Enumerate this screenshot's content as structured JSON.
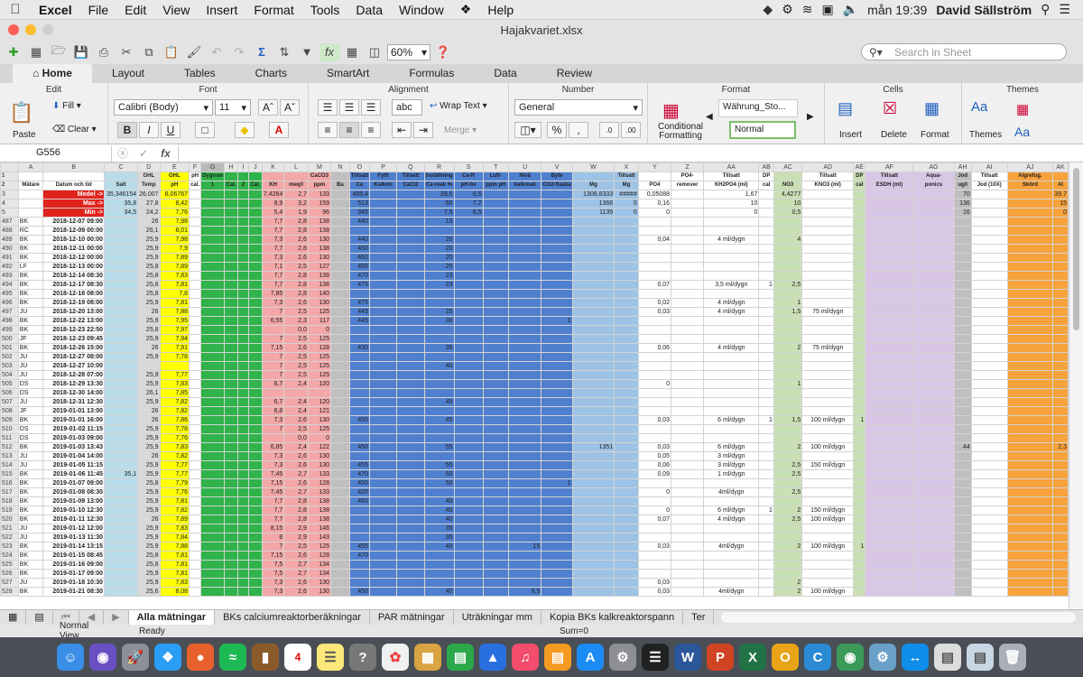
{
  "menubar": {
    "app": "Excel",
    "items": [
      "File",
      "Edit",
      "View",
      "Insert",
      "Format",
      "Tools",
      "Data",
      "Window",
      "Help"
    ],
    "clock": "mån 19:39",
    "user": "David Sällström"
  },
  "window": {
    "title": "Hajakvariet.xlsx"
  },
  "toolbar": {
    "zoom": "60%",
    "search_placeholder": "Search in Sheet"
  },
  "ribbon_tabs": [
    "Home",
    "Layout",
    "Tables",
    "Charts",
    "SmartArt",
    "Formulas",
    "Data",
    "Review"
  ],
  "ribbon": {
    "edit": {
      "label": "Edit",
      "paste": "Paste",
      "fill": "Fill",
      "clear": "Clear"
    },
    "font": {
      "label": "Font",
      "name": "Calibri (Body)",
      "size": "11",
      "bold": "B",
      "italic": "I",
      "underline": "U"
    },
    "alignment": {
      "label": "Alignment",
      "abc": "abc",
      "wrap": "Wrap Text",
      "merge": "Merge"
    },
    "number": {
      "label": "Number",
      "format": "General"
    },
    "format": {
      "label": "Format",
      "cond": "Conditional Formatting",
      "style1": "Währung_Sto...",
      "style2": "Normal"
    },
    "cells": {
      "label": "Cells",
      "insert": "Insert",
      "delete": "Delete",
      "format": "Format"
    },
    "themes": {
      "label": "Themes",
      "themes": "Themes"
    }
  },
  "formula": {
    "cell": "G556",
    "fx": "fx"
  },
  "columns": [
    "A",
    "B",
    "C",
    "D",
    "E",
    "F",
    "G",
    "H",
    "I",
    "J",
    "K",
    "L",
    "M",
    "N",
    "O",
    "P",
    "Q",
    "R",
    "S",
    "T",
    "U",
    "V",
    "W",
    "X",
    "Y",
    "Z",
    "AA",
    "AB",
    "AC",
    "AD",
    "AE",
    "AF",
    "AG",
    "AH",
    "AI",
    "AJ",
    "AK"
  ],
  "header1": [
    "",
    "",
    "",
    "GHL",
    "GHL",
    "pH",
    "Dygnsw",
    "",
    "",
    "",
    "",
    "",
    "CaCO3",
    "",
    "Tillsatt",
    "Fyllt",
    "Tillsatt",
    "Inställning",
    "Ca-R",
    "Luft-",
    "Nivå",
    "Byte",
    "",
    "Tillsatt",
    "",
    "PO4-",
    "Tillsatt",
    "DP",
    "",
    "Tillsatt",
    "DP",
    "Tillsatt",
    "Aqua-",
    "Jod",
    "Tillsatt",
    "Algrefug.",
    ""
  ],
  "header2": [
    "Mätare",
    "Datum och tid",
    "Salt",
    "Temp",
    "pH",
    "cal.",
    "1",
    "Cal.",
    "2",
    "Cal.",
    "KH",
    "meq/l",
    "ppm",
    "Ba",
    "Ca",
    "Kalkroi",
    "CaCl2",
    "Ca-reak %",
    "pH-bv",
    "ppm pH",
    "kalkreak",
    "CO2-flaska",
    "Mg",
    "Mg",
    "PO4",
    "remover",
    "KH2PO4 (ml)",
    "cal",
    "NO3",
    "KNO3 (ml)",
    "cal",
    "ESDH (ml)",
    "ponics",
    "ug/l",
    "Jod (10X)",
    "Skörd",
    "Al"
  ],
  "summary": [
    {
      "row": "3",
      "label": "Medel ->",
      "c": "35,346154",
      "d": "26,007",
      "e": "8,06767",
      "k": "7,4264",
      "l": "2,7",
      "m": "133",
      "o": "455,4",
      "r": "28,6",
      "s": "6,5",
      "w": "1308,8333",
      "x": "#####",
      "y": "0,05088",
      "aa": "1,67",
      "ac": "4,4277",
      "ah": "70",
      "ak": "39,7"
    },
    {
      "row": "4",
      "label": "Max ->",
      "c": "35,8",
      "d": "27,8",
      "e": "8,42",
      "k": "8,9",
      "l": "3,2",
      "m": "159",
      "o": "513",
      "r": "60",
      "s": "7,2",
      "w": "1366",
      "x": "0",
      "y": "0,16",
      "aa": "10",
      "ac": "10",
      "ah": "136",
      "ak": "15"
    },
    {
      "row": "5",
      "label": "Min ->",
      "c": "34,5",
      "d": "24,2",
      "e": "7,76",
      "k": "5,4",
      "l": "1,9",
      "m": "96",
      "o": "345",
      "r": "7,5",
      "s": "6,5",
      "w": "1135",
      "x": "0",
      "y": "0",
      "aa": "0",
      "ac": "0,5",
      "ah": "16",
      "ak": "0"
    }
  ],
  "rows": [
    {
      "r": "487",
      "a": "BK",
      "b": "2018-12-07 09:00",
      "d": "26",
      "e": "7,98",
      "k": "7,7",
      "l": "2,8",
      "m": "138",
      "o": "440",
      "r2": "15"
    },
    {
      "r": "488",
      "a": "RC",
      "b": "2018-12-09 00:00",
      "d": "26,1",
      "e": "8,01",
      "k": "7,7",
      "l": "2,8",
      "m": "138"
    },
    {
      "r": "489",
      "a": "BK",
      "b": "2018-12-10 00:00",
      "d": "25,9",
      "e": "7,98",
      "k": "7,3",
      "l": "2,6",
      "m": "130",
      "o": "440",
      "r2": "20",
      "y": "0,04",
      "aa": "4 ml/dygn",
      "ac": "4"
    },
    {
      "r": "490",
      "a": "BK",
      "b": "2018-12-11 00:00",
      "d": "25,9",
      "e": "7,9",
      "k": "7,7",
      "l": "2,8",
      "m": "138",
      "o": "450",
      "r2": "20"
    },
    {
      "r": "491",
      "a": "BK",
      "b": "2018-12-12 00:00",
      "d": "25,9",
      "e": "7,89",
      "k": "7,3",
      "l": "2,6",
      "m": "130",
      "o": "460",
      "r2": "20"
    },
    {
      "r": "492",
      "a": "LF",
      "b": "2018-12-13 00:00",
      "d": "25,8",
      "e": "7,89",
      "k": "7,1",
      "l": "2,5",
      "m": "127",
      "o": "450",
      "r2": "25"
    },
    {
      "r": "493",
      "a": "BK",
      "b": "2018-12-14 08:30",
      "d": "25,8",
      "e": "7,83",
      "k": "7,7",
      "l": "2,8",
      "m": "138",
      "o": "470",
      "r2": "23"
    },
    {
      "r": "494",
      "a": "BK",
      "b": "2018-12-17 08:30",
      "d": "25,8",
      "e": "7,81",
      "k": "7,7",
      "l": "2,8",
      "m": "138",
      "o": "475",
      "r2": "23",
      "y": "0,07",
      "aa": "3,5 ml/dygn",
      "ab": "1",
      "ac": "2,5"
    },
    {
      "r": "495",
      "a": "BK",
      "b": "2018-12-18 08:00",
      "d": "25,8",
      "e": "7,8",
      "k": "7,85",
      "l": "2,8",
      "m": "140"
    },
    {
      "r": "496",
      "a": "BK",
      "b": "2018-12-19 08:00",
      "d": "25,9",
      "e": "7,81",
      "k": "7,3",
      "l": "2,6",
      "m": "130",
      "o": "475",
      "y": "0,02",
      "aa": "4 ml/dygn",
      "ac": "1"
    },
    {
      "r": "497",
      "a": "JU",
      "b": "2018-12-20 13:00",
      "d": "26",
      "e": "7,88",
      "k": "7",
      "l": "2,5",
      "m": "125",
      "o": "445",
      "r2": "25",
      "y": "0,03",
      "aa": "4 ml/dygn",
      "ac": "1,5",
      "ad": "75 ml/dygn"
    },
    {
      "r": "498",
      "a": "BK",
      "b": "2018-12-22 13:00",
      "d": "25,9",
      "e": "7,95",
      "k": "6,55",
      "l": "2,3",
      "m": "117",
      "o": "445",
      "r2": "30",
      "v": "1"
    },
    {
      "r": "499",
      "a": "BK",
      "b": "2018-12-23 22:50",
      "d": "25,8",
      "e": "7,97",
      "l": "0,0",
      "m": "0"
    },
    {
      "r": "500",
      "a": "JF",
      "b": "2018-12-23 09:45",
      "d": "25,9",
      "e": "7,94",
      "k": "7",
      "l": "2,5",
      "m": "125"
    },
    {
      "r": "501",
      "a": "BK",
      "b": "2018-12-26 15:00",
      "d": "26",
      "e": "7,91",
      "k": "7,15",
      "l": "2,6",
      "m": "128",
      "o": "430",
      "r2": "35",
      "y": "0,06",
      "aa": "4 ml/dygn",
      "ac": "2",
      "ad": "75 ml/dygn"
    },
    {
      "r": "502",
      "a": "JU",
      "b": "2018-12-27 08:00",
      "d": "25,9",
      "e": "7,78",
      "k": "7",
      "l": "2,5",
      "m": "125"
    },
    {
      "r": "503",
      "a": "JU",
      "b": "2018-12-27 10:00",
      "k": "7",
      "l": "2,5",
      "m": "125",
      "r2": "40"
    },
    {
      "r": "504",
      "a": "JU",
      "b": "2018-12-28 07:00",
      "d": "25,9",
      "e": "7,77",
      "k": "7",
      "l": "2,5",
      "m": "125"
    },
    {
      "r": "505",
      "a": "DS",
      "b": "2018-12-29 13:30",
      "d": "25,9",
      "e": "7,83",
      "k": "6,7",
      "l": "2,4",
      "m": "120",
      "y": "0",
      "ac": "1"
    },
    {
      "r": "506",
      "a": "DS",
      "b": "2018-12-30 14:00",
      "d": "26,1",
      "e": "7,85"
    },
    {
      "r": "507",
      "a": "JU",
      "b": "2018-12-31 12:30",
      "d": "25,9",
      "e": "7,82",
      "k": "6,7",
      "l": "2,4",
      "m": "120",
      "r2": "45"
    },
    {
      "r": "508",
      "a": "JF",
      "b": "2019-01-01 13:00",
      "d": "26",
      "e": "7,82",
      "k": "6,8",
      "l": "2,4",
      "m": "121"
    },
    {
      "r": "509",
      "a": "BK",
      "b": "2019-01-01 16:00",
      "d": "26",
      "e": "7,86",
      "k": "7,3",
      "l": "2,6",
      "m": "130",
      "o": "450",
      "r2": "45",
      "y": "0,03",
      "aa": "6 ml/dygn",
      "ab": "1",
      "ac": "1,5",
      "ad": "100 ml/dygn",
      "ae": "1"
    },
    {
      "r": "510",
      "a": "DS",
      "b": "2019-01-02 11:15",
      "d": "25,9",
      "e": "7,78",
      "k": "7",
      "l": "2,5",
      "m": "125"
    },
    {
      "r": "511",
      "a": "DS",
      "b": "2019-01-03 09:00",
      "d": "25,9",
      "e": "7,76",
      "l": "0,0",
      "m": "0"
    },
    {
      "r": "512",
      "a": "BK",
      "b": "2019-01-03 13:43",
      "d": "25,9",
      "e": "7,83",
      "k": "6,85",
      "l": "2,4",
      "m": "122",
      "o": "450",
      "r2": "55",
      "w": "1351",
      "y": "0,03",
      "aa": "6 ml/dygn",
      "ac": "2",
      "ad": "100 ml/dygn",
      "ah": "44",
      "ak": "2,3"
    },
    {
      "r": "513",
      "a": "JU",
      "b": "2019-01-04 14:00",
      "d": "26",
      "e": "7,82",
      "k": "7,3",
      "l": "2,6",
      "m": "130",
      "y": "0,05",
      "aa": "3 ml/dygn"
    },
    {
      "r": "514",
      "a": "JU",
      "b": "2019-01-05 11:15",
      "d": "25,9",
      "e": "7,77",
      "k": "7,3",
      "l": "2,6",
      "m": "130",
      "o": "455",
      "r2": "55",
      "y": "0,06",
      "aa": "3 ml/dygn",
      "ac": "2,5",
      "ad": "150 ml/dygn"
    },
    {
      "r": "515",
      "a": "BK",
      "b": "2019-01-06 11:45",
      "c": "35,1",
      "d": "25,9",
      "e": "7,77",
      "k": "7,45",
      "l": "2,7",
      "m": "133",
      "o": "470",
      "r2": "50",
      "y": "0,09",
      "aa": "1 ml/dygn",
      "ac": "2,5"
    },
    {
      "r": "516",
      "a": "BK",
      "b": "2019-01-07 09:00",
      "d": "25,8",
      "e": "7,79",
      "k": "7,15",
      "l": "2,6",
      "m": "128",
      "o": "450",
      "r2": "50",
      "v": "1"
    },
    {
      "r": "517",
      "a": "BK",
      "b": "2019-01-08 08:30",
      "d": "25,9",
      "e": "7,76",
      "k": "7,45",
      "l": "2,7",
      "m": "133",
      "o": "420",
      "y": "0",
      "aa": "4ml/dygn",
      "ac": "2,5"
    },
    {
      "r": "518",
      "a": "BK",
      "b": "2019-01-09 13:00",
      "d": "25,9",
      "e": "7,81",
      "k": "7,7",
      "l": "2,8",
      "m": "138",
      "o": "460",
      "r2": "40"
    },
    {
      "r": "519",
      "a": "BK",
      "b": "2019-01-10 12:30",
      "d": "25,9",
      "e": "7,82",
      "k": "7,7",
      "l": "2,8",
      "m": "138",
      "r2": "40",
      "y": "0",
      "aa": "6 ml/dygn",
      "ab": "1",
      "ac": "2",
      "ad": "150 ml/dygn"
    },
    {
      "r": "520",
      "a": "BK",
      "b": "2019-01-11 12:30",
      "d": "26",
      "e": "7,89",
      "k": "7,7",
      "l": "2,8",
      "m": "138",
      "r2": "40",
      "y": "0,07",
      "aa": "4 ml/dygn",
      "ac": "2,5",
      "ad": "100 ml/dygn"
    },
    {
      "r": "521",
      "a": "JU",
      "b": "2019-01-12 12:00",
      "d": "25,9",
      "e": "7,83",
      "k": "8,15",
      "l": "2,9",
      "m": "146",
      "r2": "35"
    },
    {
      "r": "522",
      "a": "JU",
      "b": "2019-01-13 11:30",
      "d": "25,9",
      "e": "7,84",
      "k": "8",
      "l": "2,9",
      "m": "143",
      "r2": "35"
    },
    {
      "r": "523",
      "a": "BK",
      "b": "2019-01-14 13:15",
      "d": "25,9",
      "e": "7,88",
      "k": "7",
      "l": "2,5",
      "m": "125",
      "o": "455",
      "r2": "40",
      "u": "15",
      "y": "0,03",
      "aa": "4ml/dygn",
      "ac": "2",
      "ad": "100 ml/dygn",
      "ae": "1"
    },
    {
      "r": "524",
      "a": "BK",
      "b": "2019-01-15 08:45",
      "d": "25,8",
      "e": "7,81",
      "k": "7,15",
      "l": "2,6",
      "m": "128",
      "o": "470"
    },
    {
      "r": "525",
      "a": "BK",
      "b": "2019-01-16 09:00",
      "d": "25,8",
      "e": "7,81",
      "k": "7,5",
      "l": "2,7",
      "m": "134"
    },
    {
      "r": "526",
      "a": "BK",
      "b": "2019-01-17 09:00",
      "d": "25,9",
      "e": "7,81",
      "k": "7,5",
      "l": "2,7",
      "m": "134"
    },
    {
      "r": "527",
      "a": "JU",
      "b": "2019-01-18 10:30",
      "d": "25,9",
      "e": "7,83",
      "k": "7,3",
      "l": "2,6",
      "m": "130",
      "y": "0,03",
      "ac": "2"
    },
    {
      "r": "528",
      "a": "BK",
      "b": "2019-01-21 08:30",
      "d": "25,6",
      "e": "8,08",
      "k": "7,3",
      "l": "2,6",
      "m": "130",
      "o": "450",
      "r2": "40",
      "u": "9,5",
      "y": "0,03",
      "aa": "4ml/dygn",
      "ac": "2",
      "ad": "100 ml/dygn"
    }
  ],
  "sheet_tabs": [
    "Alla mätningar",
    "BKs calciumreaktorberäkningar",
    "PAR mätningar",
    "Uträkningar mm",
    "Kopia BKs kalkreaktorspann",
    "Ter"
  ],
  "status": {
    "view": "Normal View",
    "ready": "Ready",
    "sum": "Sum=0"
  },
  "colors": {
    "salt": "#b8dcea",
    "temp": "#d9d9d9",
    "ph": "#ffff00",
    "green": "#2fb34a",
    "pink": "#f4a7a7",
    "blue": "#4f7fcf",
    "lightblue": "#9dc3e6",
    "lavender": "#d9c6e6",
    "gray": "#bfbfbf",
    "orange": "#f7a23b",
    "red": "#e0231c",
    "sage": "#c9dfb4"
  }
}
